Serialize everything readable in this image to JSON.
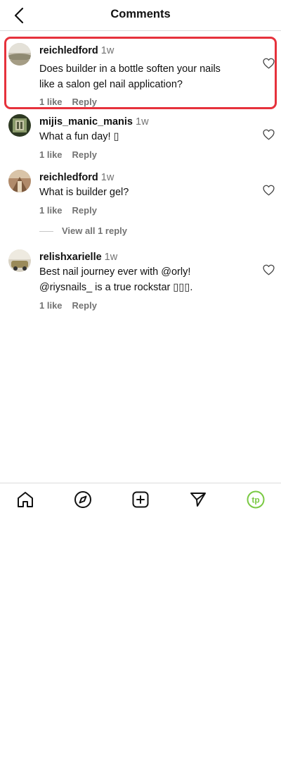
{
  "header": {
    "title": "Comments",
    "back_icon": "chevron-left-icon"
  },
  "comments": [
    {
      "user": "reichledford",
      "time": "1w",
      "text_lines": [
        "Does builder in a bottle soften your nails",
        "like a salon gel nail application?"
      ],
      "likes": "1 like",
      "reply": "Reply",
      "highlighted": true
    },
    {
      "user": "mijis_manic_manis",
      "time": "1w",
      "text_lines": [
        "What a fun day! ▯"
      ],
      "likes": "1 like",
      "reply": "Reply"
    },
    {
      "user": "reichledford",
      "time": "1w",
      "text_lines": [
        "What is builder gel?"
      ],
      "likes": "1 like",
      "reply": "Reply"
    },
    {
      "user": "relishxarielle",
      "time": "1w",
      "text_lines": [
        "Best nail journey ever with @orly!",
        "@riysnails_ is a true rockstar ▯▯▯."
      ],
      "likes": "1 like",
      "reply": "Reply"
    }
  ],
  "view_replies": "View all 1 reply",
  "bottom_nav": {
    "items": [
      "home-icon",
      "explore-icon",
      "create-icon",
      "direct-message-icon",
      "profile-icon"
    ],
    "profile_avatar_text": "tp",
    "profile_avatar_color": "#7ac943"
  },
  "colors": {
    "highlight": "#e6323c",
    "muted": "#737373",
    "divider": "#dbdbdb"
  }
}
